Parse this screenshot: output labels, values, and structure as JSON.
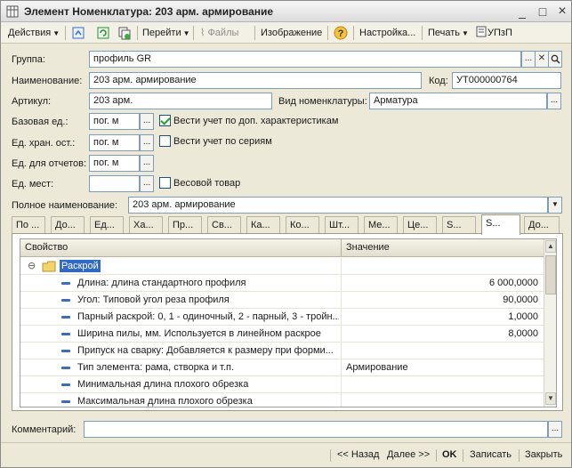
{
  "window": {
    "title": "Элемент Номенклатура: 203 арм. армирование",
    "controls": {
      "minimize": "_",
      "maximize": "□",
      "close": "×"
    }
  },
  "toolbar": {
    "actions": "Действия",
    "go": "Перейти",
    "files": "Файлы",
    "image": "Изображение",
    "help": "?",
    "settings": "Настройка...",
    "print": "Печать",
    "upzp": "УПзП"
  },
  "form": {
    "group_label": "Группа:",
    "group_value": "профиль GR",
    "name_label": "Наименование:",
    "name_value": "203 арм. армирование",
    "code_label": "Код:",
    "code_value": "УТ000000764",
    "article_label": "Артикул:",
    "article_value": "203 арм.",
    "kind_label": "Вид номенклатуры:",
    "kind_value": "Арматура",
    "base_unit_label": "Базовая ед.:",
    "base_unit_value": "пог. м",
    "track_chars_label": "Вести учет по доп. характеристикам",
    "track_chars_checked": true,
    "storage_unit_label": "Ед. хран. ост.:",
    "storage_unit_value": "пог. м",
    "track_series_label": "Вести учет по сериям",
    "track_series_checked": false,
    "report_unit_label": "Ед. для отчетов:",
    "report_unit_value": "пог. м",
    "places_unit_label": "Ед. мест:",
    "places_unit_value": "",
    "weight_label": "Весовой товар",
    "weight_checked": false,
    "full_name_label": "Полное наименование:",
    "full_name_value": "203 арм. армирование",
    "comment_label": "Комментарий:",
    "comment_value": ""
  },
  "tabs": [
    "По ...",
    "До...",
    "Ед...",
    "Ха...",
    "Пр...",
    "Св...",
    "Ка...",
    "Ко...",
    "Шт...",
    "Ме...",
    "Це...",
    "S...",
    "S...",
    "До..."
  ],
  "active_tab": 12,
  "grid": {
    "headers": {
      "property": "Свойство",
      "value": "Значение"
    },
    "group_row": {
      "toggle": "⊖",
      "label": "Раскрой"
    },
    "rows": [
      {
        "property": "Длина: длина стандартного профиля",
        "value": "6 000,0000",
        "numeric": true
      },
      {
        "property": "Угол: Типовой угол реза профиля",
        "value": "90,0000",
        "numeric": true
      },
      {
        "property": "Парный раскрой: 0, 1 - одиночный, 2 - парный, 3 - тройн...",
        "value": "1,0000",
        "numeric": true
      },
      {
        "property": "Ширина пилы, мм. Используется в линейном раскрое",
        "value": "8,0000",
        "numeric": true
      },
      {
        "property": "Припуск на сварку: Добавляется к размеру при форми...",
        "value": "",
        "numeric": false
      },
      {
        "property": "Тип элемента: рама, створка и т.п.",
        "value": "Армирование",
        "numeric": false
      },
      {
        "property": "Минимальная длина плохого обрезка",
        "value": "",
        "numeric": false
      },
      {
        "property": "Максимальная длина плохого обрезка",
        "value": "",
        "numeric": false
      }
    ]
  },
  "bottom": {
    "back": "<< Назад",
    "next": "Далее >>",
    "ok": "OK",
    "save": "Записать",
    "close": "Закрыть"
  },
  "colors": {
    "accent": "#316ac5",
    "window_bg": "#ece9d8",
    "field_border": "#7f9db9"
  }
}
